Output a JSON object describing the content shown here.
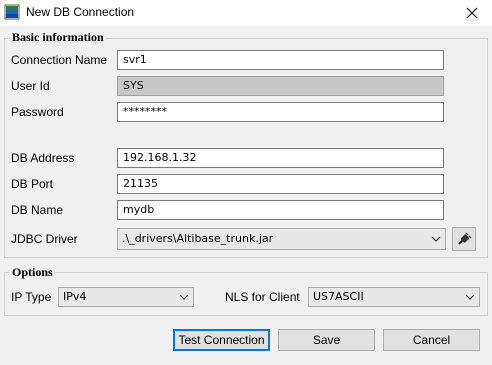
{
  "window": {
    "title": "New DB Connection",
    "icon": "database-icon",
    "close_icon": "close-icon"
  },
  "basic": {
    "legend": "Basic information",
    "connection_name": {
      "label": "Connection Name",
      "value": "svr1"
    },
    "user_id": {
      "label": "User Id",
      "value": "SYS"
    },
    "password": {
      "label": "Password",
      "value": "********"
    },
    "db_address": {
      "label": "DB Address",
      "value": "192.168.1.32"
    },
    "db_port": {
      "label": "DB Port",
      "value": "21135"
    },
    "db_name": {
      "label": "DB Name",
      "value": "mydb"
    },
    "jdbc_driver": {
      "label": "JDBC Driver",
      "value": ".\\_drivers\\Altibase_trunk.jar",
      "browse_icon": "plug-icon"
    }
  },
  "options": {
    "legend": "Options",
    "ip_type": {
      "label": "IP Type",
      "value": "IPv4"
    },
    "nls": {
      "label": "NLS for Client",
      "value": "US7ASCII"
    }
  },
  "buttons": {
    "test": "Test Connection",
    "save": "Save",
    "cancel": "Cancel"
  },
  "colors": {
    "accent": "#0078d7",
    "window_bg": "#f0f0f0",
    "disabled_field": "#c8c8c8"
  }
}
